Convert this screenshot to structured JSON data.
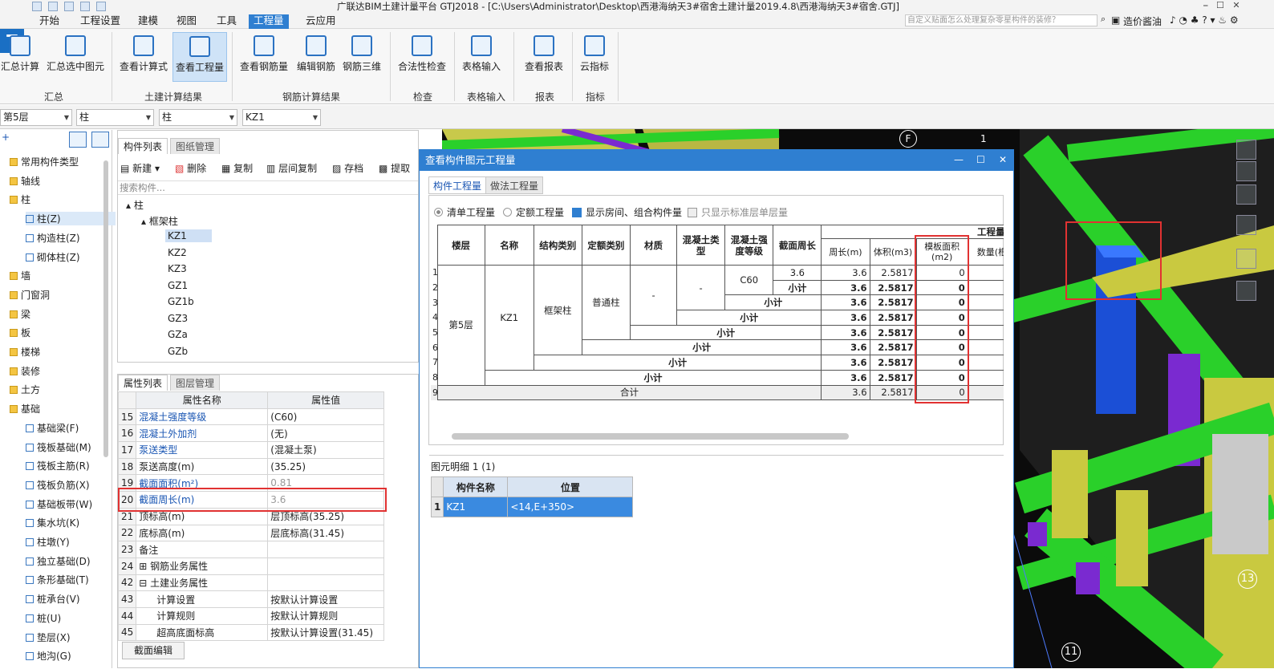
{
  "window": {
    "title": "广联达BIM土建计量平台 GTJ2018 - [C:\\Users\\Administrator\\Desktop\\西港海纳天3#宿舍土建计量2019.4.8\\西港海纳天3#宿舍.GTJ]"
  },
  "menu": [
    "开始",
    "工程设置",
    "建模",
    "视图",
    "工具",
    "工程量",
    "云应用"
  ],
  "menu_active_index": 5,
  "search": {
    "placeholder": "自定义贴面怎么处理复杂零星构件的装修？"
  },
  "topright": {
    "user": "造价酱油"
  },
  "ribbon": {
    "buttons": [
      {
        "label": "汇总计算",
        "icon": "sigma-icon"
      },
      {
        "label": "汇总选中图元",
        "icon": "sum-selected-icon"
      },
      {
        "label": "查看计算式",
        "icon": "view-formula-icon"
      },
      {
        "label": "查看工程量",
        "icon": "view-quantity-icon"
      },
      {
        "label": "查看钢筋量",
        "icon": "view-rebar-icon"
      },
      {
        "label": "编辑钢筋",
        "icon": "edit-rebar-icon"
      },
      {
        "label": "钢筋三维",
        "icon": "rebar-3d-icon"
      },
      {
        "label": "合法性检查",
        "icon": "check-icon"
      },
      {
        "label": "表格输入",
        "icon": "table-input-icon"
      },
      {
        "label": "查看报表",
        "icon": "report-icon"
      },
      {
        "label": "云指标",
        "icon": "cloud-icon"
      }
    ],
    "groups": [
      "汇总",
      "土建计算结果",
      "钢筋计算结果",
      "检查",
      "表格输入",
      "报表",
      "指标"
    ]
  },
  "combos": [
    "第5层",
    "柱",
    "柱",
    "KZ1"
  ],
  "leftnav": [
    {
      "label": "常用构件类型",
      "level": 0
    },
    {
      "label": "轴线",
      "level": 0
    },
    {
      "label": "柱",
      "level": 0
    },
    {
      "label": "柱(Z)",
      "level": 1,
      "selected": true
    },
    {
      "label": "构造柱(Z)",
      "level": 1
    },
    {
      "label": "砌体柱(Z)",
      "level": 1
    },
    {
      "label": "墙",
      "level": 0
    },
    {
      "label": "门窗洞",
      "level": 0
    },
    {
      "label": "梁",
      "level": 0
    },
    {
      "label": "板",
      "level": 0
    },
    {
      "label": "楼梯",
      "level": 0
    },
    {
      "label": "装修",
      "level": 0
    },
    {
      "label": "土方",
      "level": 0
    },
    {
      "label": "基础",
      "level": 0
    },
    {
      "label": "基础梁(F)",
      "level": 1
    },
    {
      "label": "筏板基础(M)",
      "level": 1
    },
    {
      "label": "筏板主筋(R)",
      "level": 1
    },
    {
      "label": "筏板负筋(X)",
      "level": 1
    },
    {
      "label": "基础板带(W)",
      "level": 1
    },
    {
      "label": "集水坑(K)",
      "level": 1
    },
    {
      "label": "柱墩(Y)",
      "level": 1
    },
    {
      "label": "独立基础(D)",
      "level": 1
    },
    {
      "label": "条形基础(T)",
      "level": 1
    },
    {
      "label": "桩承台(V)",
      "level": 1
    },
    {
      "label": "桩(U)",
      "level": 1
    },
    {
      "label": "垫层(X)",
      "level": 1
    },
    {
      "label": "地沟(G)",
      "level": 1
    }
  ],
  "complist": {
    "tabs": [
      "构件列表",
      "图纸管理"
    ],
    "toolbar": [
      "新建",
      "删除",
      "复制",
      "层间复制",
      "存档",
      "提取"
    ],
    "search_placeholder": "搜索构件...",
    "tree_root": "柱",
    "tree_group": "框架柱",
    "items": [
      "KZ1",
      "KZ2",
      "KZ3",
      "GZ1",
      "GZ1b",
      "GZ3",
      "GZa",
      "GZb"
    ],
    "selected": "KZ1"
  },
  "props": {
    "tabs": [
      "属性列表",
      "图层管理"
    ],
    "headers": [
      "属性名称",
      "属性值"
    ],
    "rows": [
      {
        "n": "15",
        "name": "混凝土强度等级",
        "value": "(C60)",
        "style": "blue"
      },
      {
        "n": "16",
        "name": "混凝土外加剂",
        "value": "(无)",
        "style": "blue"
      },
      {
        "n": "17",
        "name": "泵送类型",
        "value": "(混凝土泵)",
        "style": "blue"
      },
      {
        "n": "18",
        "name": "泵送高度(m)",
        "value": "(35.25)",
        "style": ""
      },
      {
        "n": "19",
        "name": "截面面积(m²)",
        "value": "0.81",
        "style": "blue-gray"
      },
      {
        "n": "20",
        "name": "截面周长(m)",
        "value": "3.6",
        "style": "blue-gray"
      },
      {
        "n": "21",
        "name": "顶标高(m)",
        "value": "层顶标高(35.25)",
        "style": ""
      },
      {
        "n": "22",
        "name": "底标高(m)",
        "value": "层底标高(31.45)",
        "style": ""
      },
      {
        "n": "23",
        "name": "备注",
        "value": "",
        "style": ""
      },
      {
        "n": "24",
        "name": "钢筋业务属性",
        "value": "",
        "style": "expand"
      },
      {
        "n": "42",
        "name": "土建业务属性",
        "value": "",
        "style": "collapse"
      },
      {
        "n": "43",
        "name": "计算设置",
        "value": "按默认计算设置",
        "style": "child"
      },
      {
        "n": "44",
        "name": "计算规则",
        "value": "按默认计算规则",
        "style": "child"
      },
      {
        "n": "45",
        "name": "超高底面标高",
        "value": "按默认计算设置(31.45)",
        "style": "child"
      }
    ],
    "section_edit": "截面编辑"
  },
  "dialog": {
    "title": "查看构件图元工程量",
    "tabs": [
      "构件工程量",
      "做法工程量"
    ],
    "options": [
      {
        "label": "清单工程量",
        "type": "radio",
        "checked": false
      },
      {
        "label": "定额工程量",
        "type": "radio",
        "checked": false
      },
      {
        "label": "显示房间、组合构件量",
        "type": "check",
        "checked": true
      },
      {
        "label": "只显示标准层单层量",
        "type": "check",
        "checked": true,
        "disabled": true
      }
    ],
    "table": {
      "group_header": "工程量名",
      "headers": [
        "楼层",
        "名称",
        "结构类别",
        "定额类别",
        "材质",
        "混凝土类型",
        "混凝土强度等级",
        "截面周长",
        "周长(m)",
        "体积(m3)",
        "模板面积(m2)",
        "数量(根"
      ],
      "floor": "第5层",
      "name": "KZ1",
      "struct": "框架柱",
      "quota": "普通柱",
      "material": "-",
      "concrete_type": "-",
      "grade": "C60",
      "perim_val": "3.6",
      "subtotal_label": "小计",
      "total_label": "合计",
      "row_numbers": [
        "1",
        "2",
        "3",
        "4",
        "5",
        "6",
        "7",
        "8",
        "9"
      ],
      "rows": [
        {
          "perimeter": "3.6",
          "volume": "2.5817",
          "formwork": "0"
        },
        {
          "perimeter": "3.6",
          "volume": "2.5817",
          "formwork": "0"
        },
        {
          "perimeter": "3.6",
          "volume": "2.5817",
          "formwork": "0"
        },
        {
          "perimeter": "3.6",
          "volume": "2.5817",
          "formwork": "0"
        },
        {
          "perimeter": "3.6",
          "volume": "2.5817",
          "formwork": "0"
        },
        {
          "perimeter": "3.6",
          "volume": "2.5817",
          "formwork": "0"
        },
        {
          "perimeter": "3.6",
          "volume": "2.5817",
          "formwork": "0"
        },
        {
          "perimeter": "3.6",
          "volume": "2.5817",
          "formwork": "0"
        },
        {
          "perimeter": "3.6",
          "volume": "2.5817",
          "formwork": "0"
        }
      ]
    },
    "detail": {
      "label": "图元明细  1 (1)",
      "headers": [
        "构件名称",
        "位置"
      ],
      "rows": [
        {
          "n": "1",
          "name": "KZ1",
          "position": "<14,E+350>"
        }
      ]
    }
  },
  "viewport": {
    "axis_labels": [
      "F",
      "1",
      "13",
      "11"
    ]
  }
}
